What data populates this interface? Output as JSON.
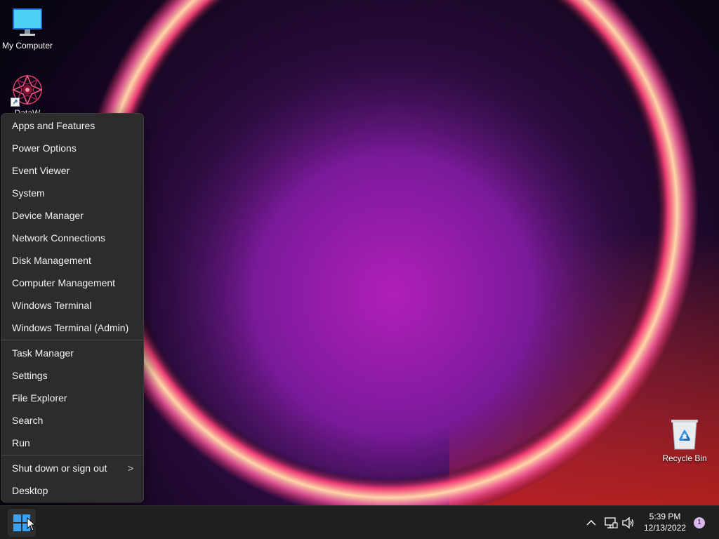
{
  "desktop": {
    "icons": [
      {
        "label": "My Computer",
        "icon": "monitor-icon"
      },
      {
        "label": "DataW",
        "icon": "flower-mandala-icon"
      },
      {
        "label": "Recycle Bin",
        "icon": "recycle-bin-icon"
      }
    ]
  },
  "context_menu": {
    "group1": [
      "Apps and Features",
      "Power Options",
      "Event Viewer",
      "System",
      "Device Manager",
      "Network Connections",
      "Disk Management",
      "Computer Management",
      "Windows Terminal",
      "Windows Terminal (Admin)"
    ],
    "group2": [
      "Task Manager",
      "Settings",
      "File Explorer",
      "Search",
      "Run"
    ],
    "group3": [
      "Shut down or sign out",
      "Desktop"
    ],
    "submenu_chevron": ">"
  },
  "taskbar": {
    "start_icon": "windows-logo-icon",
    "tray": {
      "icons": [
        "chevron-up-icon",
        "network-icon",
        "volume-icon"
      ],
      "time": "5:39 PM",
      "date": "12/13/2022",
      "notification_count": "1"
    }
  },
  "colors": {
    "menu_background": "#2c2c2c",
    "taskbar_background": "#1f1f1f",
    "accent_blue": "#3aa0f2"
  }
}
